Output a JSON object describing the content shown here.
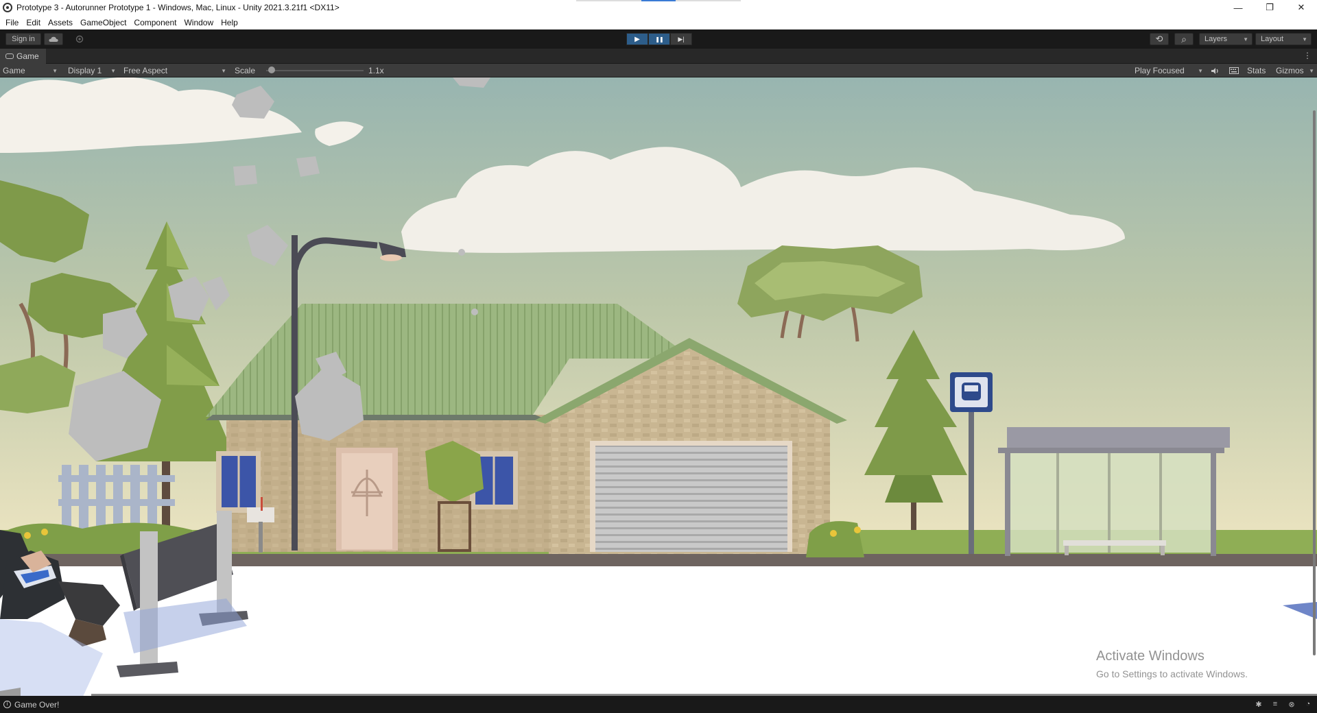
{
  "window": {
    "title": "Prototype 3 - Autorunner Prototype 1 - Windows, Mac, Linux - Unity 2021.3.21f1 <DX11>",
    "controls": {
      "minimize": "—",
      "maximize": "❐",
      "close": "✕"
    }
  },
  "menu": [
    "File",
    "Edit",
    "Assets",
    "GameObject",
    "Component",
    "Window",
    "Help"
  ],
  "toolbar": {
    "sign_in": "Sign in",
    "cloud_icon": "cloud-icon",
    "collab_icon": "collab-icon",
    "play_icon": "▶",
    "pause_icon": "❚❚",
    "step_icon": "▶|",
    "history_icon": "⟲",
    "search_icon": "⌕",
    "layers": "Layers",
    "layout": "Layout"
  },
  "tab": {
    "label": "Game",
    "menu_icon": "⋮"
  },
  "game_controls": {
    "mode": "Game",
    "display": "Display 1",
    "aspect": "Free Aspect",
    "scale_label": "Scale",
    "scale_value": "1.1x",
    "play_focused": "Play Focused",
    "stats": "Stats",
    "gizmos": "Gizmos"
  },
  "watermark": {
    "line1": "Activate Windows",
    "line2": "Go to Settings to activate Windows."
  },
  "status": {
    "message": "Game Over!"
  },
  "colors": {
    "editor_dark": "#191919",
    "panel": "#3c3c3c",
    "play_active": "#2d5d8a",
    "sky_top": "#9fb8b2",
    "sky_bottom": "#efe7c6",
    "roof": "#9bb47f",
    "ground": "#ffffff"
  }
}
